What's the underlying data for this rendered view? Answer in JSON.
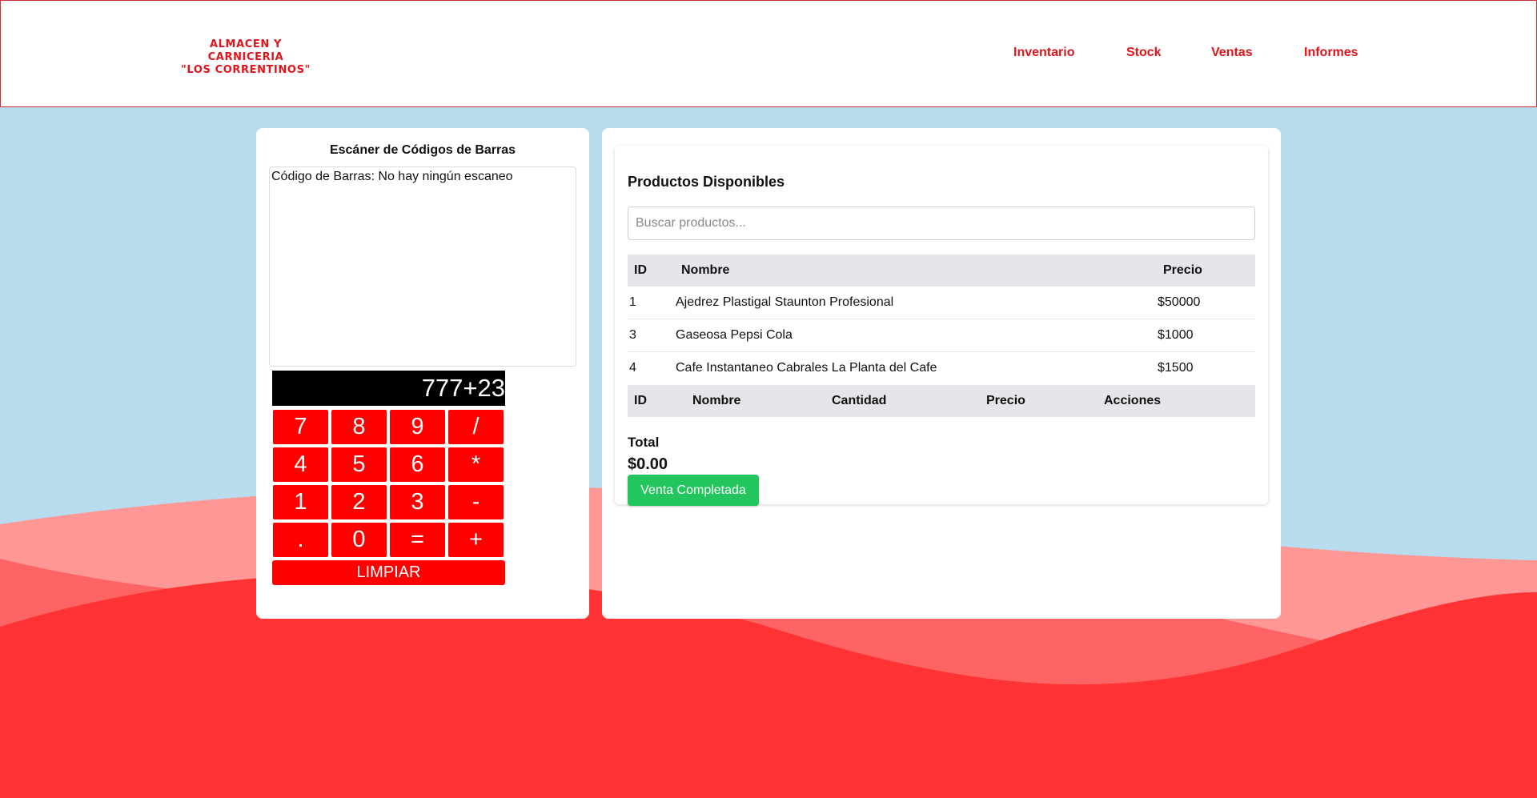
{
  "header": {
    "logo_line1": "ALMACEN Y CARNICERIA",
    "logo_line2": "\"LOS CORRENTINOS\"",
    "nav": [
      "Inventario",
      "Stock",
      "Ventas",
      "Informes"
    ]
  },
  "scanner": {
    "title": "Escáner de Códigos de Barras",
    "status_text": "Código de Barras: No hay ningún escaneo"
  },
  "calculator": {
    "display": "777+23",
    "keys": [
      "7",
      "8",
      "9",
      "/",
      "4",
      "5",
      "6",
      "*",
      "1",
      "2",
      "3",
      "-",
      ".",
      "0",
      "=",
      "+"
    ],
    "clear_label": "LIMPIAR"
  },
  "products": {
    "title": "Productos Disponibles",
    "search_placeholder": "Buscar productos...",
    "columns": [
      "ID",
      "Nombre",
      "Precio"
    ],
    "rows": [
      {
        "id": "1",
        "name": "Ajedrez Plastigal Staunton Profesional",
        "price": "$50000"
      },
      {
        "id": "3",
        "name": "Gaseosa Pepsi Cola",
        "price": "$1000"
      },
      {
        "id": "4",
        "name": "Cafe Instantaneo Cabrales La Planta del Cafe",
        "price": "$1500"
      }
    ],
    "cart_columns": [
      "ID",
      "Nombre",
      "Cantidad",
      "Precio",
      "Acciones"
    ],
    "total_label": "Total",
    "total_value": "$0.00",
    "complete_label": "Venta Completada"
  },
  "colors": {
    "brand_red": "#e0141b",
    "background_sky": "#b7dcee",
    "wave_light": "#ff9797",
    "wave_mid": "#ff6464",
    "wave_dark": "#ff3333",
    "button_green": "#22c55e"
  }
}
